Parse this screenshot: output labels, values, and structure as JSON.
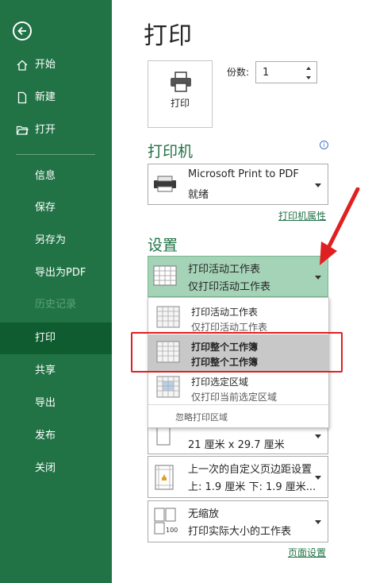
{
  "sidebar": {
    "back_icon": "arrow-left-circle-icon",
    "items": [
      {
        "label": "开始",
        "icon": "home-icon"
      },
      {
        "label": "新建",
        "icon": "new-document-icon"
      },
      {
        "label": "打开",
        "icon": "open-folder-icon"
      },
      {
        "label": "信息"
      },
      {
        "label": "保存"
      },
      {
        "label": "另存为"
      },
      {
        "label": "导出为PDF"
      },
      {
        "label": "历史记录"
      },
      {
        "label": "打印"
      },
      {
        "label": "共享"
      },
      {
        "label": "导出"
      },
      {
        "label": "发布"
      },
      {
        "label": "关闭"
      }
    ],
    "selected": "打印",
    "disabled": "历史记录"
  },
  "main": {
    "title": "打印",
    "print_button": "打印",
    "copies_label": "份数:",
    "copies_value": "1",
    "printer_heading": "打印机",
    "printer": {
      "name": "Microsoft Print to PDF",
      "status": "就绪"
    },
    "printer_properties_link": "打印机属性",
    "settings_heading": "设置",
    "settings_selected": {
      "line1": "打印活动工作表",
      "line2": "仅打印活动工作表"
    },
    "options": [
      {
        "line1": "打印活动工作表",
        "line2": "仅打印活动工作表"
      },
      {
        "line1": "打印整个工作簿",
        "line2": "打印整个工作簿"
      },
      {
        "line1": "打印选定区域",
        "line2": "仅打印当前选定区域"
      }
    ],
    "ignore_print_area": "忽略打印区域",
    "paper_size": "21 厘米 x 29.7 厘米",
    "margins": {
      "line1": "上一次的自定义页边距设置",
      "line2": "上: 1.9 厘米 下: 1.9 厘米..."
    },
    "scaling": {
      "line1": "无缩放",
      "line2": "打印实际大小的工作表"
    },
    "page_setup_link": "页面设置"
  },
  "colors": {
    "accent": "#217346",
    "selected_nav": "#0e5c2f",
    "highlight": "#e02020"
  }
}
